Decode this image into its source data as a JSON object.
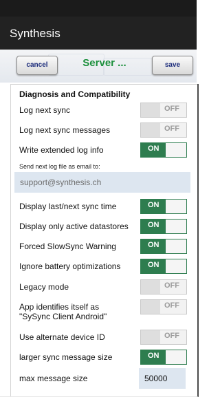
{
  "appbar": {
    "title": "Synthesis"
  },
  "toolbar": {
    "cancel_label": "cancel",
    "server_title": "Server ...",
    "save_label": "save"
  },
  "settings": {
    "section_title": "Diagnosis and Compatibility",
    "log_next_sync": {
      "label": "Log next sync",
      "state": "OFF"
    },
    "log_next_sync_messages": {
      "label": "Log next sync messages",
      "state": "OFF"
    },
    "write_extended_log": {
      "label": "Write extended log info",
      "state": "ON"
    },
    "send_log_label": "Send next log file as email to:",
    "send_log_email": "support@synthesis.ch",
    "display_last_next": {
      "label": "Display last/next sync time",
      "state": "ON"
    },
    "display_active": {
      "label": "Display only active datastores",
      "state": "ON"
    },
    "forced_slowsync": {
      "label": "Forced SlowSync Warning",
      "state": "ON"
    },
    "ignore_battery": {
      "label": "Ignore battery optimizations",
      "state": "ON"
    },
    "legacy_mode": {
      "label": "Legacy mode",
      "state": "OFF"
    },
    "app_identifies_line1": "App identifies itself as",
    "app_identifies_line2": "\"SySync Client Android\"",
    "app_identifies": {
      "state": "OFF"
    },
    "alternate_device_id": {
      "label": "Use alternate device ID",
      "state": "OFF"
    },
    "larger_message": {
      "label": "larger sync message size",
      "state": "ON"
    },
    "max_message_size": {
      "label": "max message size",
      "value": "50000"
    }
  }
}
